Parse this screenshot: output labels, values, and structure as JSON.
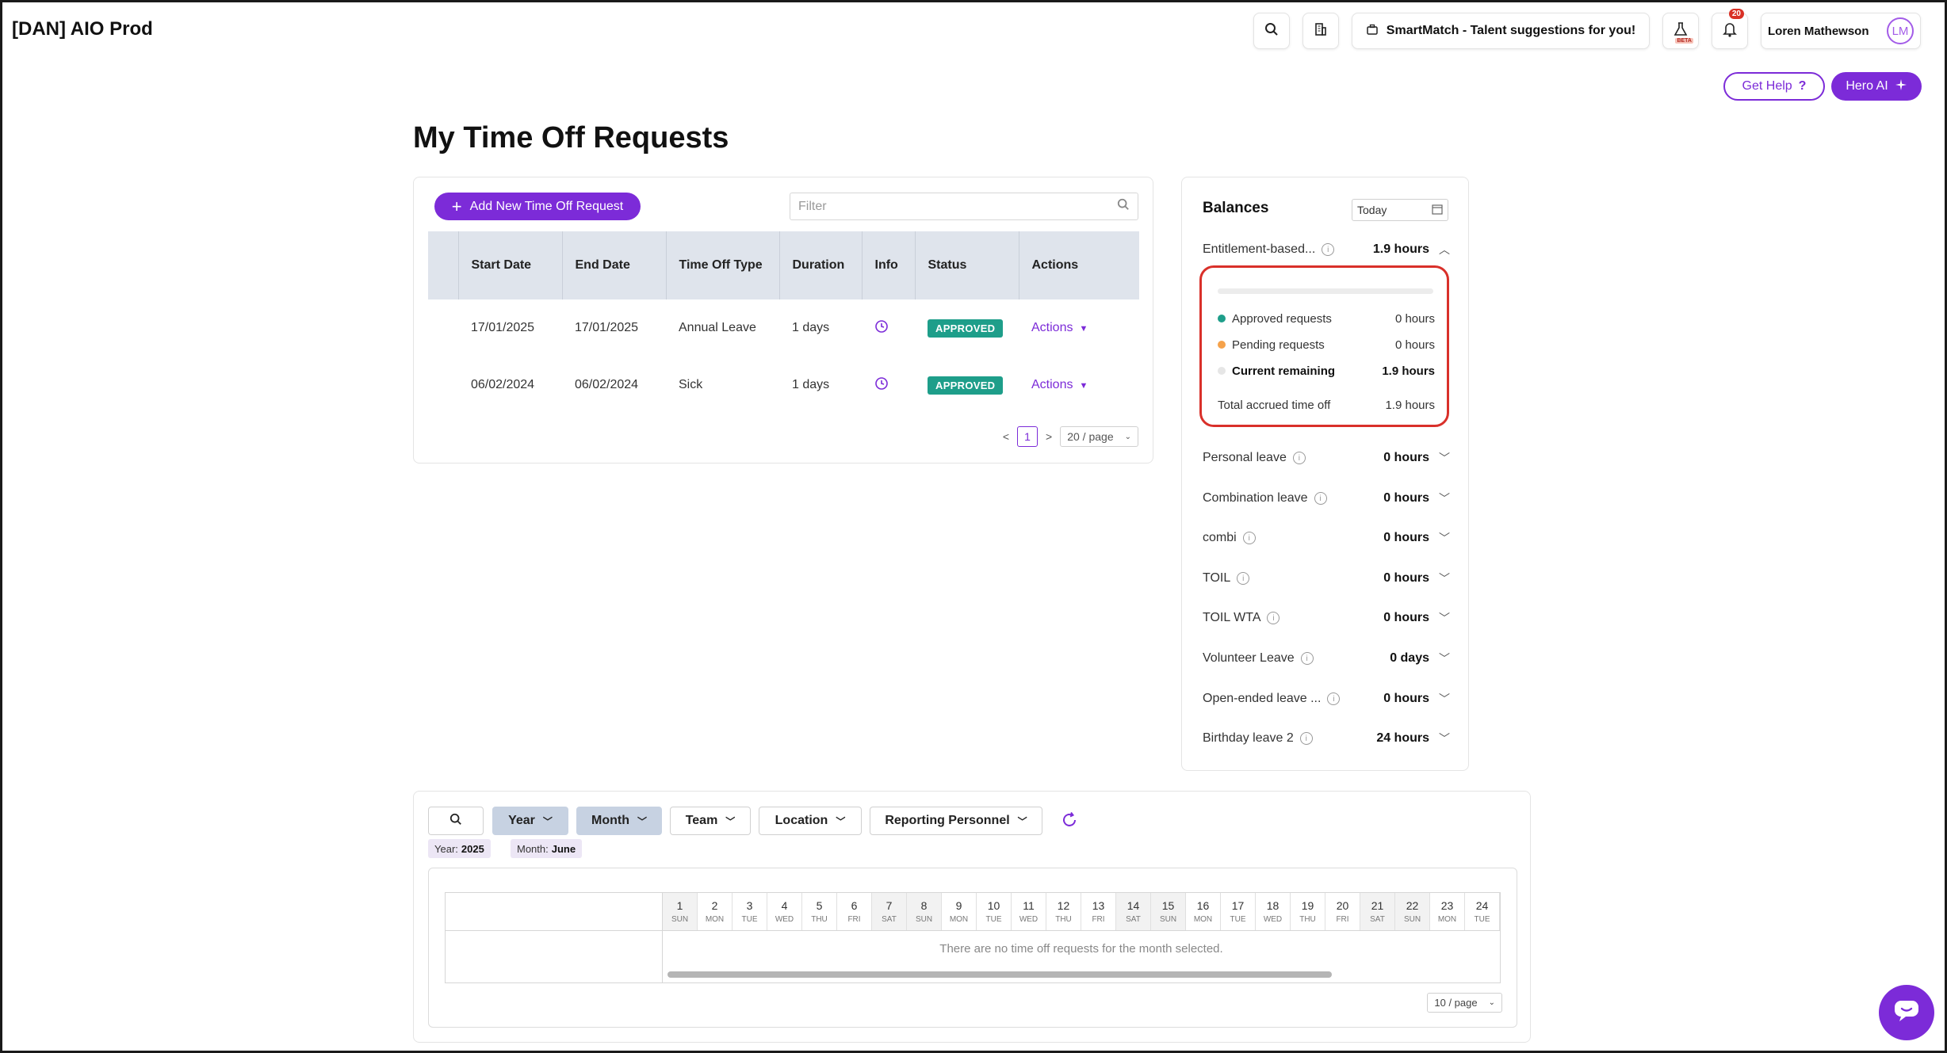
{
  "app": {
    "title": "[DAN] AIO Prod"
  },
  "topbar": {
    "smartmatch_label": "SmartMatch - Talent suggestions for you!",
    "beta_label": "BETA",
    "notifications_count": "20",
    "user_name": "Loren Mathewson",
    "user_initials": "LM",
    "get_help_label": "Get Help",
    "hero_ai_label": "Hero AI"
  },
  "page": {
    "title": "My Time Off Requests"
  },
  "requests": {
    "add_button_label": "Add New Time Off Request",
    "filter_placeholder": "Filter",
    "columns": [
      "Start Date",
      "End Date",
      "Time Off Type",
      "Duration",
      "Info",
      "Status",
      "Actions"
    ],
    "rows": [
      {
        "start": "17/01/2025",
        "end": "17/01/2025",
        "type": "Annual Leave",
        "duration": "1 days",
        "status": "APPROVED",
        "actions": "Actions"
      },
      {
        "start": "06/02/2024",
        "end": "06/02/2024",
        "type": "Sick",
        "duration": "1 days",
        "status": "APPROVED",
        "actions": "Actions"
      }
    ],
    "pagination": {
      "prev": "<",
      "current": "1",
      "next": ">",
      "page_size": "20 / page"
    }
  },
  "balances": {
    "title": "Balances",
    "date_value": "Today",
    "entitlement": {
      "label": "Entitlement-based...",
      "value": "1.9 hours",
      "approved_label": "Approved requests",
      "approved_value": "0 hours",
      "pending_label": "Pending requests",
      "pending_value": "0 hours",
      "remaining_label": "Current remaining",
      "remaining_value": "1.9 hours",
      "accrued_label": "Total accrued time off",
      "accrued_value": "1.9 hours"
    },
    "items": [
      {
        "label": "Personal leave",
        "value": "0 hours"
      },
      {
        "label": "Combination leave",
        "value": "0 hours"
      },
      {
        "label": "combi",
        "value": "0 hours"
      },
      {
        "label": "TOIL",
        "value": "0 hours"
      },
      {
        "label": "TOIL WTA",
        "value": "0 hours"
      },
      {
        "label": "Volunteer Leave",
        "value": "0 days"
      },
      {
        "label": "Open-ended leave ...",
        "value": "0 hours"
      },
      {
        "label": "Birthday leave 2",
        "value": "24 hours"
      }
    ],
    "colors": {
      "approved": "#1e9e8a",
      "pending": "#f5a24b",
      "remaining": "#e6e6e6"
    }
  },
  "calendar": {
    "filters": {
      "year": "Year",
      "month": "Month",
      "team": "Team",
      "location": "Location",
      "reporting": "Reporting Personnel"
    },
    "chips": {
      "year_label": "Year:",
      "year_value": "2025",
      "month_label": "Month:",
      "month_value": "June"
    },
    "days": [
      {
        "n": "1",
        "w": "SUN"
      },
      {
        "n": "2",
        "w": "MON"
      },
      {
        "n": "3",
        "w": "TUE"
      },
      {
        "n": "4",
        "w": "WED"
      },
      {
        "n": "5",
        "w": "THU"
      },
      {
        "n": "6",
        "w": "FRI"
      },
      {
        "n": "7",
        "w": "SAT"
      },
      {
        "n": "8",
        "w": "SUN"
      },
      {
        "n": "9",
        "w": "MON"
      },
      {
        "n": "10",
        "w": "TUE"
      },
      {
        "n": "11",
        "w": "WED"
      },
      {
        "n": "12",
        "w": "THU"
      },
      {
        "n": "13",
        "w": "FRI"
      },
      {
        "n": "14",
        "w": "SAT"
      },
      {
        "n": "15",
        "w": "SUN"
      },
      {
        "n": "16",
        "w": "MON"
      },
      {
        "n": "17",
        "w": "TUE"
      },
      {
        "n": "18",
        "w": "WED"
      },
      {
        "n": "19",
        "w": "THU"
      },
      {
        "n": "20",
        "w": "FRI"
      },
      {
        "n": "21",
        "w": "SAT"
      },
      {
        "n": "22",
        "w": "SUN"
      },
      {
        "n": "23",
        "w": "MON"
      },
      {
        "n": "24",
        "w": "TUE"
      }
    ],
    "empty_message": "There are no time off requests for the month selected.",
    "page_size": "10 / page"
  },
  "colors": {
    "brand": "#7c2bd8",
    "approved": "#1e9e8a",
    "highlight_border": "#d9302a"
  }
}
